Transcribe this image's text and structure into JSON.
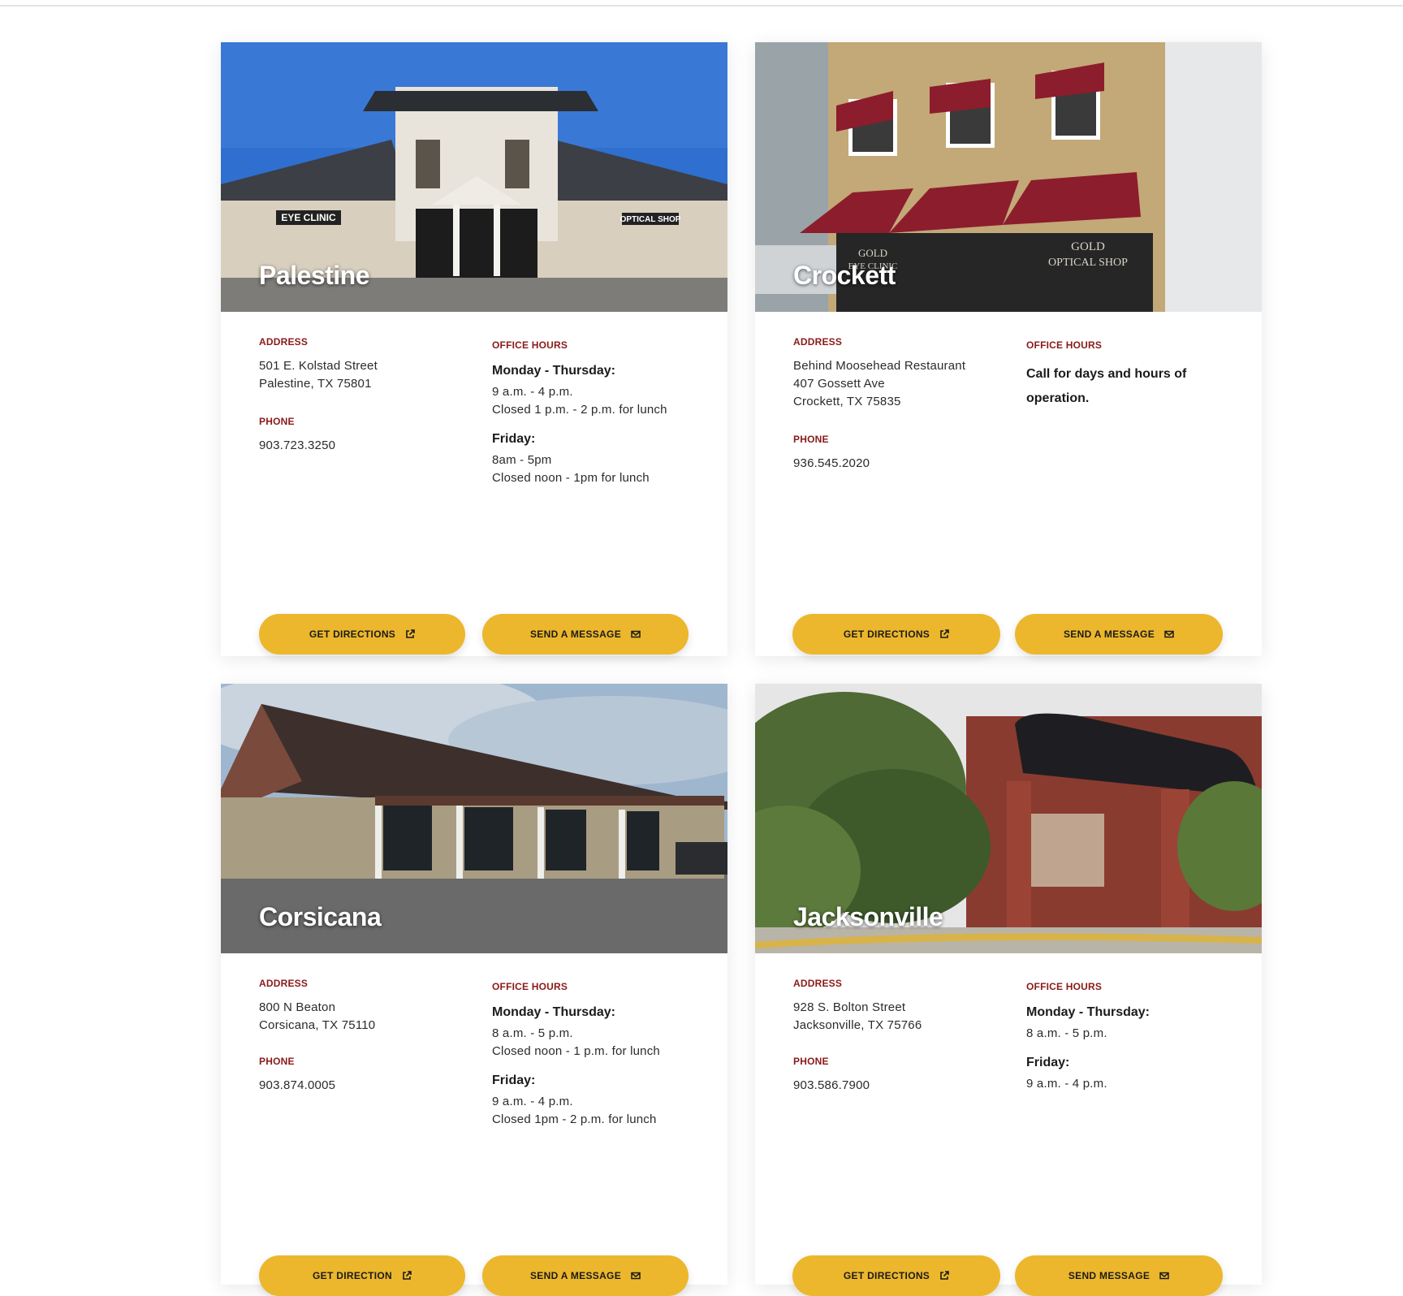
{
  "labels": {
    "address": "ADDRESS",
    "phone": "PHONE",
    "hours": "OFFICE HOURS"
  },
  "locations": [
    {
      "city": "Palestine",
      "address_line1": "501 E. Kolstad Street",
      "address_line2": "Palestine, TX 75801",
      "phone": "903.723.3250",
      "hours": [
        {
          "title": "Monday - Thursday:",
          "line1": "9 a.m. - 4 p.m.",
          "line2": "Closed 1 p.m. - 2 p.m. for lunch"
        },
        {
          "title": "Friday:",
          "line1": "8am - 5pm",
          "line2": "Closed noon - 1pm for lunch"
        }
      ],
      "photo_signs": [
        "EYE CLINIC",
        "OPTICAL SHOP"
      ],
      "directions_label": "GET DIRECTIONS",
      "message_label": "SEND A MESSAGE"
    },
    {
      "city": "Crockett",
      "address_line1": "Behind Moosehead Restaurant",
      "address_line2": "407 Gossett Ave",
      "address_line3": "Crockett, TX 75835",
      "phone": "936.545.2020",
      "hours_note": "Call for days and hours of operation.",
      "photo_signs": [
        "GOLD",
        "EYE CLINIC",
        "GOLD",
        "OPTICAL SHOP"
      ],
      "directions_label": "GET DIRECTIONS",
      "message_label": "SEND A MESSAGE"
    },
    {
      "city": "Corsicana",
      "address_line1": "800 N Beaton",
      "address_line2": "Corsicana, TX 75110",
      "phone": "903.874.0005",
      "hours": [
        {
          "title": "Monday - Thursday:",
          "line1": "8 a.m. - 5 p.m.",
          "line2": "Closed noon - 1 p.m. for lunch"
        },
        {
          "title": "Friday:",
          "line1": "9 a.m. - 4 p.m.",
          "line2": "Closed 1pm - 2 p.m. for lunch"
        }
      ],
      "directions_label": "GET DIRECTION",
      "message_label": "SEND A MESSAGE"
    },
    {
      "city": "Jacksonville",
      "address_line1": "928 S. Bolton Street",
      "address_line2": "Jacksonville, TX 75766",
      "phone": "903.586.7900",
      "hours": [
        {
          "title": "Monday - Thursday:",
          "line1": "8 a.m. - 5 p.m."
        },
        {
          "title": "Friday:",
          "line1": "9 a.m. - 4 p.m."
        }
      ],
      "directions_label": "GET DIRECTIONS",
      "message_label": "SEND MESSAGE"
    }
  ],
  "colors": {
    "label_red": "#8a1a1a",
    "button_gold": "#ecb72c"
  },
  "icons": {
    "directions": "external-link-icon",
    "message": "envelope-icon"
  }
}
